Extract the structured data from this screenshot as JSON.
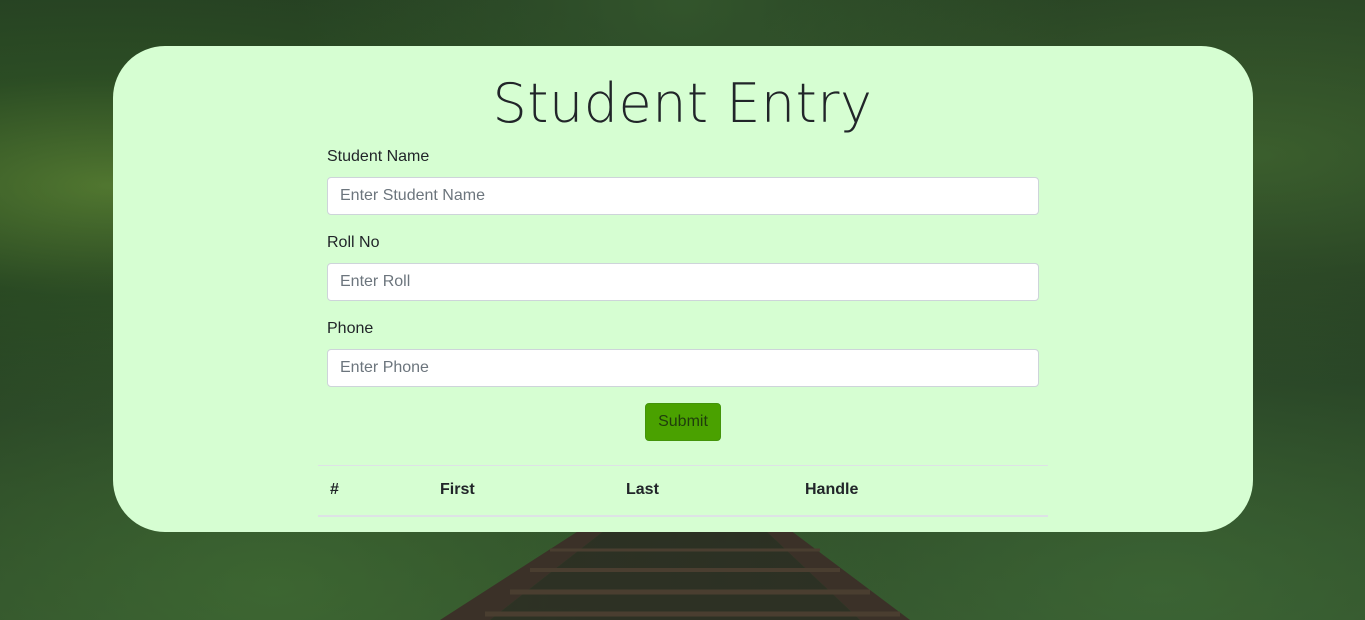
{
  "page": {
    "title": "Student Entry"
  },
  "form": {
    "fields": [
      {
        "label": "Student Name",
        "placeholder": "Enter Student Name",
        "value": ""
      },
      {
        "label": "Roll No",
        "placeholder": "Enter Roll",
        "value": ""
      },
      {
        "label": "Phone",
        "placeholder": "Enter Phone",
        "value": ""
      }
    ],
    "submit_label": "Submit"
  },
  "table": {
    "headers": [
      "#",
      "First",
      "Last",
      "Handle"
    ],
    "rows": []
  },
  "colors": {
    "card_background": "#d6fed2",
    "submit_button": "#4aa100"
  }
}
